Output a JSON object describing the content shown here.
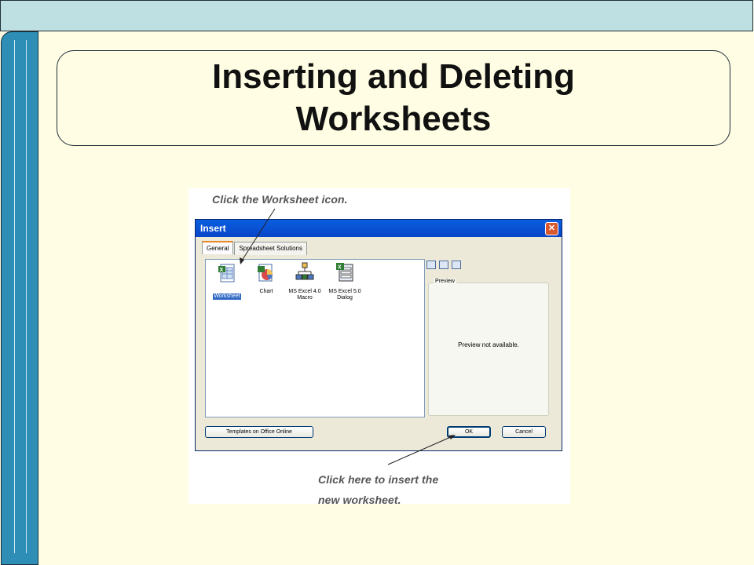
{
  "slide": {
    "title_line1": "Inserting and Deleting",
    "title_line2": "Worksheets"
  },
  "screenshot": {
    "caption_top": "Click the Worksheet icon.",
    "caption_bottom_line1": "Click here to insert the",
    "caption_bottom_line2": "new worksheet.",
    "dialog": {
      "title": "Insert",
      "close_glyph": "✕",
      "tabs": [
        {
          "label": "General",
          "active": true
        },
        {
          "label": "Spreadsheet Solutions",
          "active": false
        }
      ],
      "items": [
        {
          "label": "Worksheet",
          "icon": "worksheet-icon",
          "selected": true
        },
        {
          "label": "Chart",
          "icon": "chart-icon",
          "selected": false
        },
        {
          "label": "MS Excel 4.0 Macro",
          "icon": "macro-icon",
          "selected": false
        },
        {
          "label": "MS Excel 5.0 Dialog",
          "icon": "dialog-sheet-icon",
          "selected": false
        }
      ],
      "preview_legend": "Preview",
      "preview_message": "Preview not available.",
      "templates_button": "Templates on Office Online",
      "ok_button": "OK",
      "cancel_button": "Cancel"
    }
  },
  "colors": {
    "background": "#FFFDE3",
    "top_bar": "#BFE0E2",
    "left_bar": "#2E8EB6",
    "xp_title": "#0A5FE0",
    "selection": "#316AC5"
  }
}
